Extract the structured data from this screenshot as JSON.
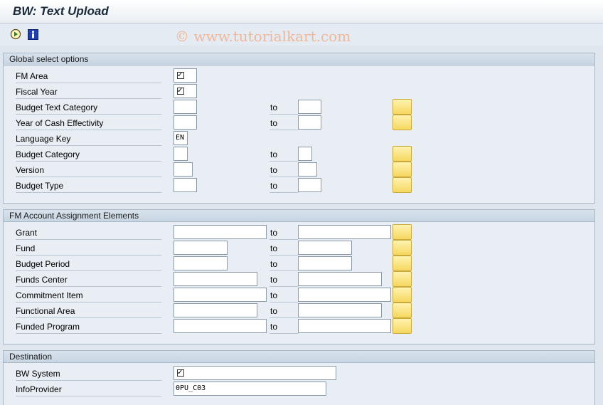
{
  "window": {
    "title": "BW: Text Upload"
  },
  "toolbar": {
    "execute_icon": "execute-icon",
    "info_icon": "info-icon"
  },
  "watermark": "© www.tutorialkart.com",
  "global": {
    "header": "Global select options",
    "to_label": "to",
    "fm_area": {
      "label": "FM Area",
      "checked": true
    },
    "fiscal_year": {
      "label": "Fiscal Year",
      "checked": true
    },
    "budget_text_category": {
      "label": "Budget Text Category",
      "value": "",
      "to_value": ""
    },
    "year_cash_effectivity": {
      "label": "Year of Cash Effectivity",
      "value": "",
      "to_value": ""
    },
    "language_key": {
      "label": "Language Key",
      "value": "EN"
    },
    "budget_category": {
      "label": "Budget Category",
      "value": "",
      "to_value": ""
    },
    "version": {
      "label": "Version",
      "value": "",
      "to_value": ""
    },
    "budget_type": {
      "label": "Budget Type",
      "value": "",
      "to_value": ""
    }
  },
  "fm": {
    "header": "FM Account Assignment Elements",
    "to_label": "to",
    "grant": {
      "label": "Grant",
      "value": "",
      "to_value": ""
    },
    "fund": {
      "label": "Fund",
      "value": "",
      "to_value": ""
    },
    "budget_period": {
      "label": "Budget Period",
      "value": "",
      "to_value": ""
    },
    "funds_center": {
      "label": "Funds Center",
      "value": "",
      "to_value": ""
    },
    "commitment_item": {
      "label": "Commitment Item",
      "value": "",
      "to_value": ""
    },
    "functional_area": {
      "label": "Functional Area",
      "value": "",
      "to_value": ""
    },
    "funded_program": {
      "label": "Funded Program",
      "value": "",
      "to_value": ""
    }
  },
  "destination": {
    "header": "Destination",
    "bw_system": {
      "label": "BW System",
      "checked": true
    },
    "infoprovider": {
      "label": "InfoProvider",
      "value": "0PU_C03"
    }
  },
  "colors": {
    "background": "#dfe6ee",
    "multi_button": "#f5d760",
    "watermark": "#f0b89a"
  }
}
